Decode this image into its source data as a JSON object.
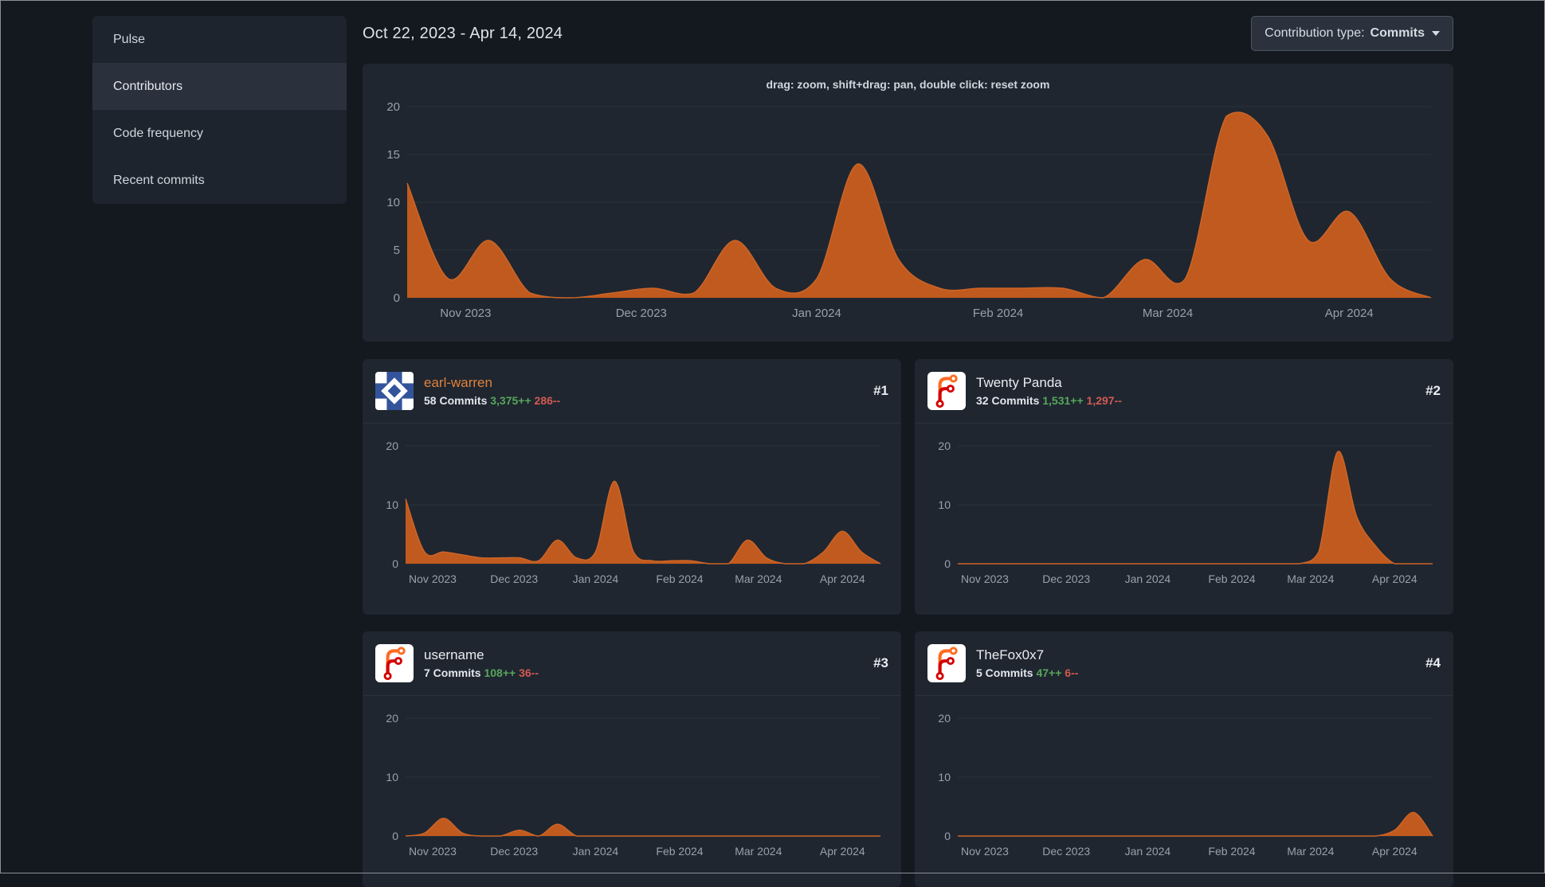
{
  "sidebar": {
    "items": [
      {
        "label": "Pulse",
        "active": false
      },
      {
        "label": "Contributors",
        "active": true
      },
      {
        "label": "Code frequency",
        "active": false
      },
      {
        "label": "Recent commits",
        "active": false
      }
    ]
  },
  "header": {
    "date_range": "Oct 22, 2023 - Apr 14, 2024"
  },
  "controls": {
    "label": "Contribution type:",
    "value": "Commits",
    "icon": "caret-down-icon"
  },
  "chart_data": {
    "type": "area",
    "unit": "commits per week",
    "x_range": [
      "Oct 22, 2023",
      "Apr 14, 2024"
    ],
    "x_tick_labels": [
      "Nov 2023",
      "Dec 2023",
      "Jan 2024",
      "Feb 2024",
      "Mar 2024",
      "Apr 2024"
    ],
    "x_tick_positions": [
      0.0571,
      0.2286,
      0.4,
      0.5771,
      0.7429,
      0.92
    ],
    "grid": "horizontal",
    "colors": {
      "area": "#c05a1e",
      "area_stroke": "#cd6527",
      "additions": "#57a65a",
      "deletions": "#d25a52",
      "link": "#e0813a"
    },
    "main": {
      "hint": "drag: zoom, shift+drag: pan, double click: reset zoom",
      "ylim": [
        0,
        20
      ],
      "yticks": [
        0,
        5,
        10,
        15,
        20
      ],
      "values": [
        12,
        2,
        6,
        0.5,
        0,
        0.5,
        1,
        0.5,
        6,
        1,
        2,
        14,
        4,
        1,
        1,
        1,
        1,
        0,
        4,
        2,
        19,
        17,
        6,
        9,
        2,
        0
      ]
    },
    "contributors": [
      {
        "rank": "#1",
        "name": "earl-warren",
        "commits": "58 Commits",
        "additions": "3,375++",
        "deletions": "286--",
        "avatar": "identicon",
        "ylim": [
          0,
          20
        ],
        "yticks": [
          0,
          10,
          20
        ],
        "values": [
          11,
          2,
          2,
          1.5,
          1,
          1,
          1,
          0.5,
          4,
          1,
          2,
          14,
          2,
          0.5,
          0.5,
          0.5,
          0,
          0,
          4,
          1,
          0,
          0,
          2,
          5.5,
          2,
          0
        ]
      },
      {
        "rank": "#2",
        "name": "Twenty Panda",
        "commits": "32 Commits",
        "additions": "1,531++",
        "deletions": "1,297--",
        "avatar": "forgejo-logo",
        "ylim": [
          0,
          20
        ],
        "yticks": [
          0,
          10,
          20
        ],
        "values": [
          0,
          0,
          0,
          0,
          0,
          0,
          0,
          0,
          0,
          0,
          0,
          0,
          0,
          0,
          0,
          0,
          0,
          0,
          0,
          2,
          19,
          8,
          3,
          0,
          0,
          0
        ]
      },
      {
        "rank": "#3",
        "name": "username",
        "commits": "7 Commits",
        "additions": "108++",
        "deletions": "36--",
        "avatar": "forgejo-logo",
        "ylim": [
          0,
          20
        ],
        "yticks": [
          0,
          10,
          20
        ],
        "values": [
          0,
          0.5,
          3,
          0.5,
          0,
          0,
          1,
          0,
          2,
          0,
          0,
          0,
          0,
          0,
          0,
          0,
          0,
          0,
          0,
          0,
          0,
          0,
          0,
          0,
          0,
          0
        ]
      },
      {
        "rank": "#4",
        "name": "TheFox0x7",
        "commits": "5 Commits",
        "additions": "47++",
        "deletions": "6--",
        "avatar": "forgejo-logo",
        "ylim": [
          0,
          20
        ],
        "yticks": [
          0,
          10,
          20
        ],
        "values": [
          0,
          0,
          0,
          0,
          0,
          0,
          0,
          0,
          0,
          0,
          0,
          0,
          0,
          0,
          0,
          0,
          0,
          0,
          0,
          0,
          0,
          0,
          0,
          1,
          4,
          0
        ]
      }
    ]
  }
}
